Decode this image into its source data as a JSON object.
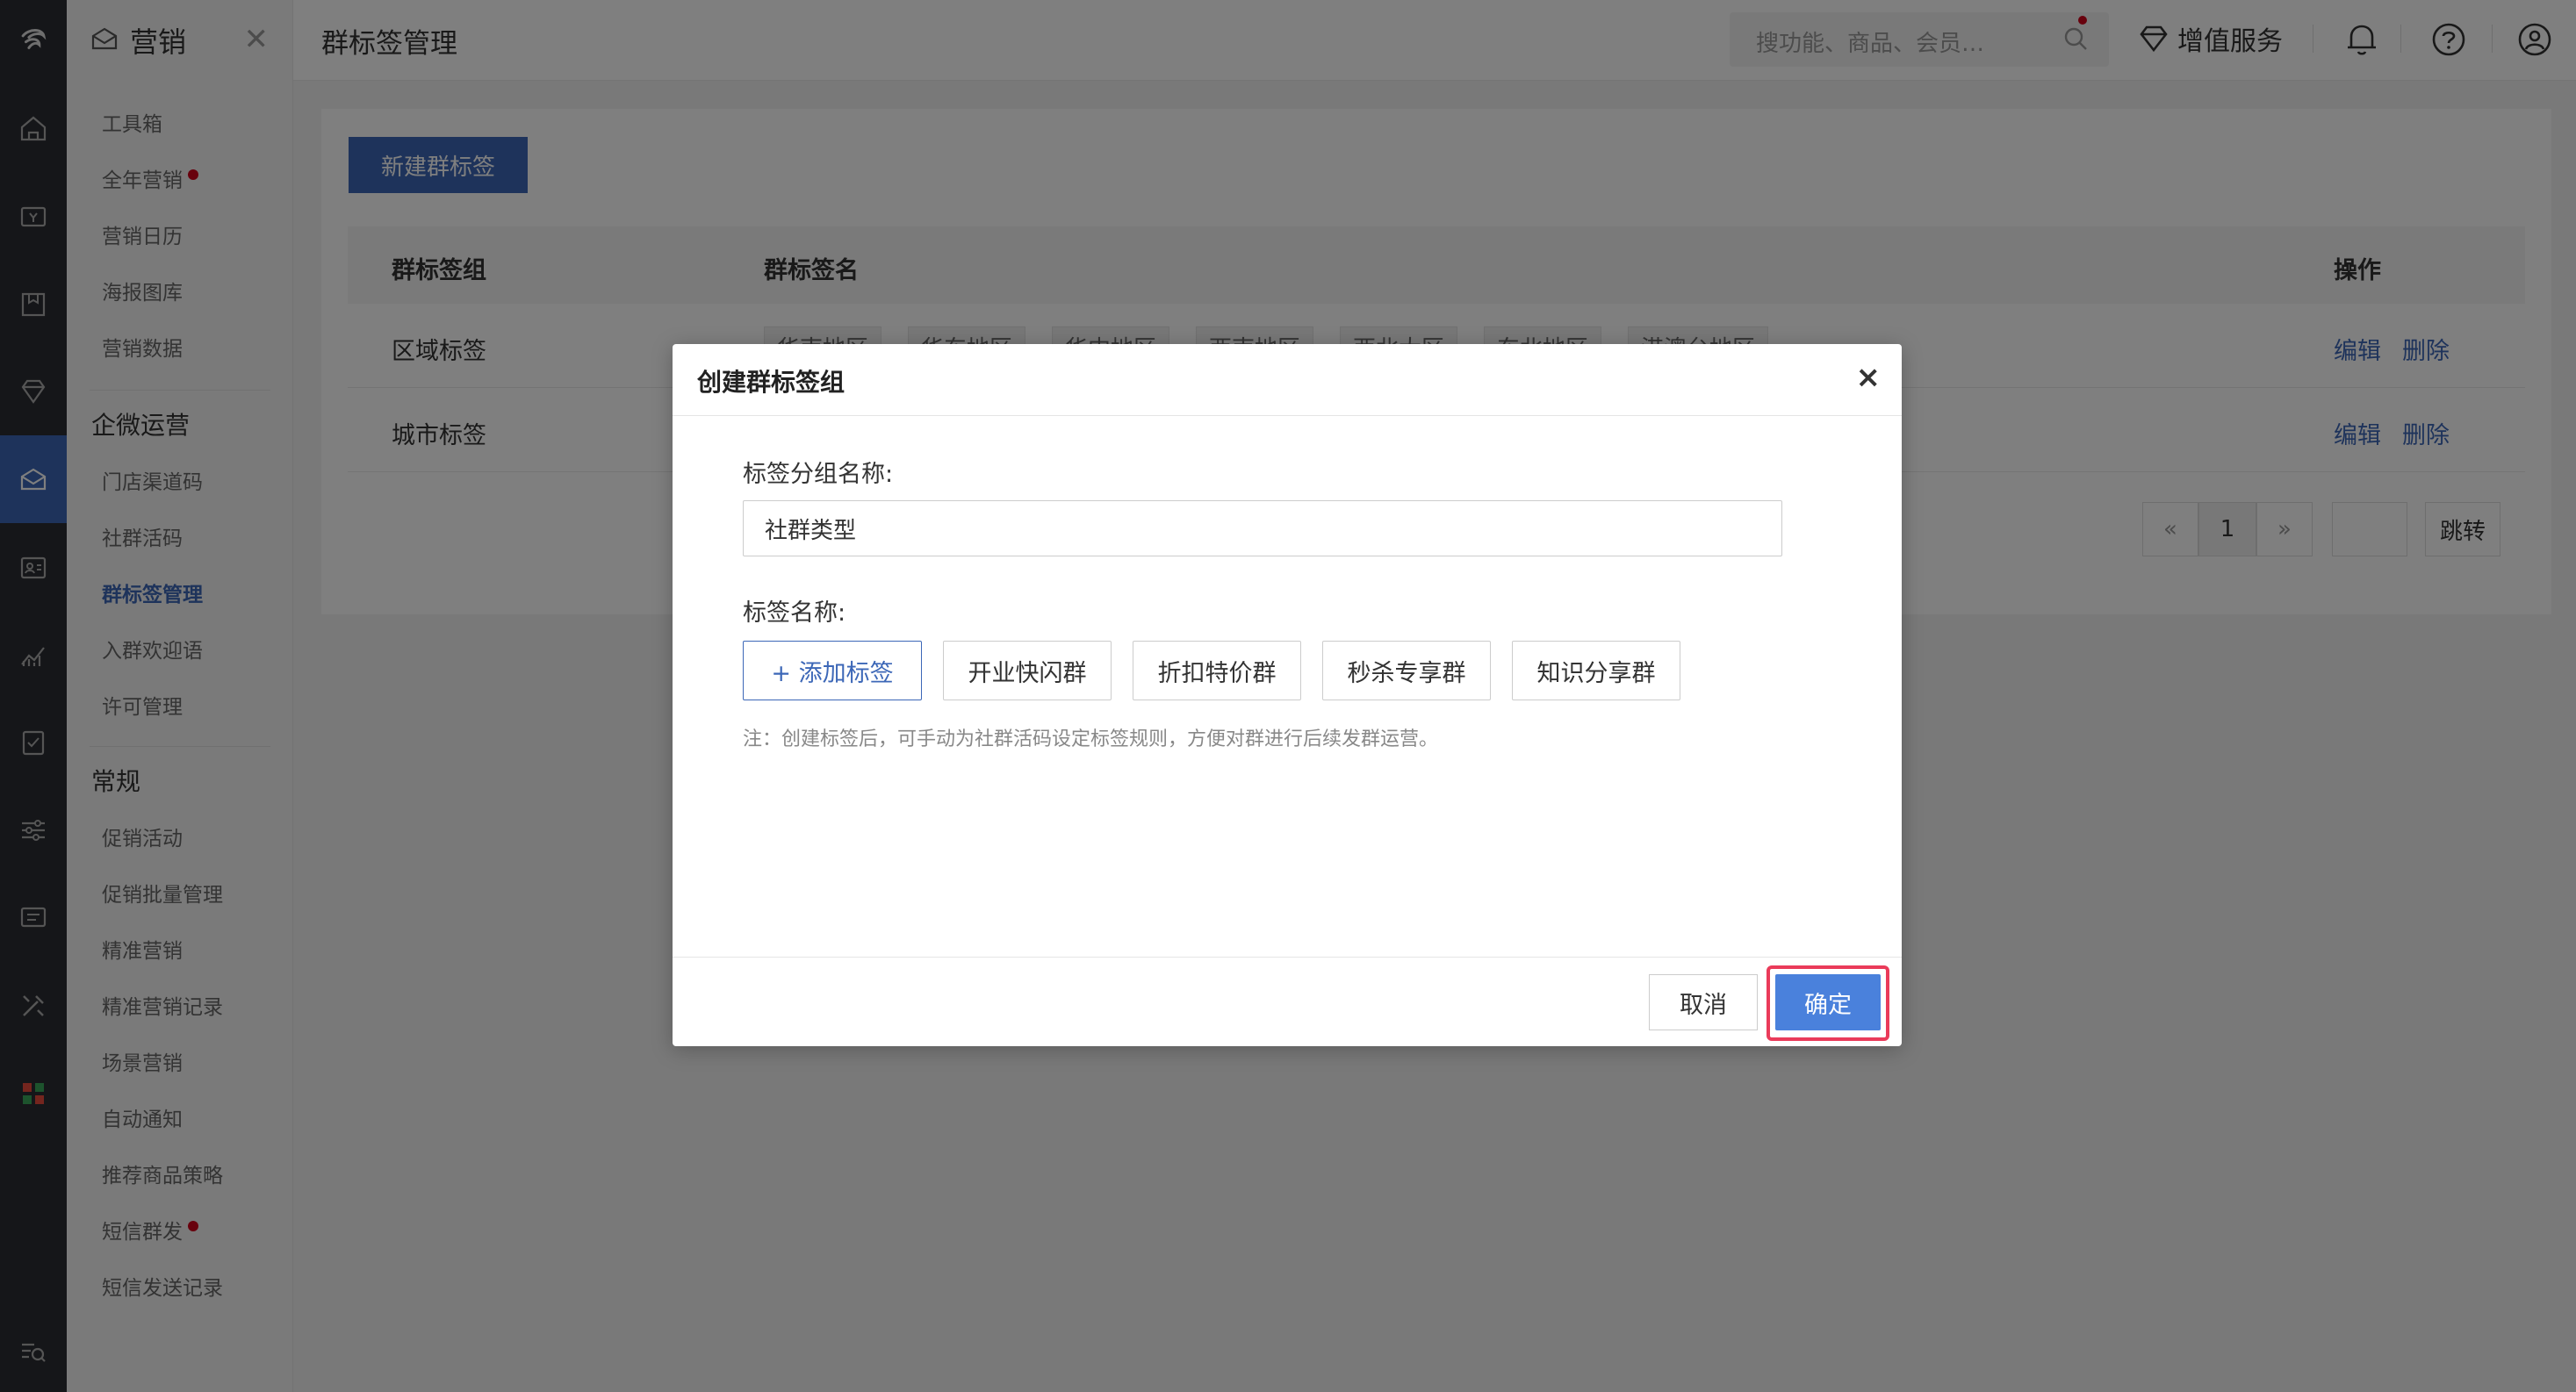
{
  "sidebar": {
    "title": "营销",
    "items_a": [
      "工具箱",
      "全年营销",
      "营销日历",
      "海报图库",
      "营销数据"
    ],
    "group_b": "企微运营",
    "items_b": [
      "门店渠道码",
      "社群活码",
      "群标签管理",
      "入群欢迎语",
      "许可管理"
    ],
    "group_c": "常规",
    "items_c": [
      "促销活动",
      "促销批量管理",
      "精准营销",
      "精准营销记录",
      "场景营销",
      "自动通知",
      "推荐商品策略",
      "短信群发",
      "短信发送记录"
    ]
  },
  "topbar": {
    "page_title": "群标签管理",
    "search_placeholder": "搜功能、商品、会员…",
    "vas": "增值服务"
  },
  "main": {
    "new_button": "新建群标签",
    "columns": [
      "群标签组",
      "群标签名",
      "操作"
    ],
    "rows": [
      {
        "group": "区域标签",
        "edit": "编辑",
        "delete": "删除"
      },
      {
        "group": "城市标签",
        "edit": "编辑",
        "delete": "删除"
      }
    ],
    "region_chips": [
      "华南地区",
      "华东地区",
      "华中地区",
      "西南地区",
      "西北大区",
      "东北地区",
      "港澳台地区"
    ],
    "pager": {
      "prev": "«",
      "page": "1",
      "next": "»",
      "jump": "跳转"
    }
  },
  "modal": {
    "title": "创建群标签组",
    "close": "×",
    "group_name_label": "标签分组名称:",
    "group_name_value": "社群类型",
    "tag_name_label": "标签名称:",
    "add_tag": "+ 添加标签",
    "tags": [
      "开业快闪群",
      "折扣特价群",
      "秒杀专享群",
      "知识分享群"
    ],
    "note": "注：创建标签后，可手动为社群活码设定标签规则，方便对群进行后续发群运营。",
    "cancel": "取消",
    "confirm": "确定"
  },
  "colors": {
    "accent": "#3c67b7",
    "confirm": "#4a81dc",
    "highlight": "#ea3b5a",
    "rail": "#2b2d33"
  }
}
